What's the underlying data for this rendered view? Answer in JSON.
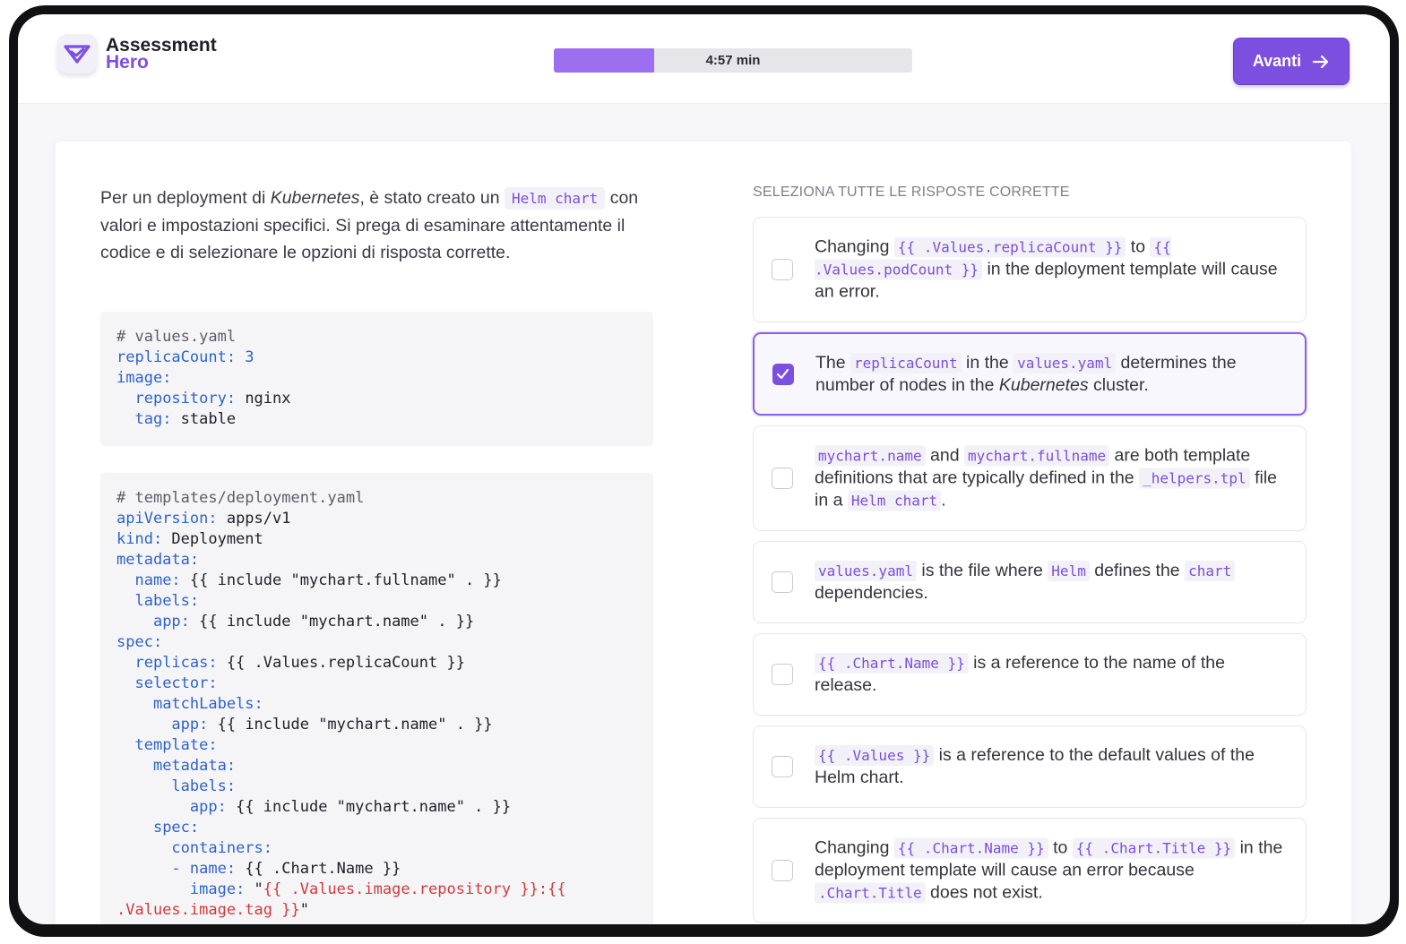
{
  "header": {
    "logo_line1": "Assessment",
    "logo_line2": "Hero",
    "timer_label": "4:57 min",
    "timer_progress": 0.28,
    "next_button": "Avanti"
  },
  "question": {
    "part1": "Per un deployment di ",
    "italic": "Kubernetes",
    "part2": ", è stato creato un ",
    "code": "Helm chart",
    "part3": " con valori e impostazioni specifici. Si prega di esaminare attentamente il codice e di selezionare le opzioni di risposta corrette."
  },
  "code_values": [
    [
      [
        "c",
        "# values.yaml"
      ]
    ],
    [
      [
        "k",
        "replicaCount: 3"
      ]
    ],
    [
      [
        "k",
        "image:"
      ]
    ],
    [
      [
        "",
        "  "
      ],
      [
        "k",
        "repository:"
      ],
      [
        "",
        " nginx"
      ]
    ],
    [
      [
        "",
        "  "
      ],
      [
        "k",
        "tag:"
      ],
      [
        "",
        " stable"
      ]
    ]
  ],
  "code_deployment": [
    [
      [
        "c",
        "# templates/deployment.yaml"
      ]
    ],
    [
      [
        "k",
        "apiVersion:"
      ],
      [
        "",
        " apps/v1"
      ]
    ],
    [
      [
        "k",
        "kind:"
      ],
      [
        "",
        " Deployment"
      ]
    ],
    [
      [
        "k",
        "metadata:"
      ]
    ],
    [
      [
        "",
        "  "
      ],
      [
        "k",
        "name:"
      ],
      [
        "",
        " {{ include \"mychart.fullname\" . }}"
      ]
    ],
    [
      [
        "",
        "  "
      ],
      [
        "k",
        "labels:"
      ]
    ],
    [
      [
        "",
        "    "
      ],
      [
        "k",
        "app:"
      ],
      [
        "",
        " {{ include \"mychart.name\" . }}"
      ]
    ],
    [
      [
        "k",
        "spec:"
      ]
    ],
    [
      [
        "",
        "  "
      ],
      [
        "k",
        "replicas:"
      ],
      [
        "",
        " {{ .Values.replicaCount }}"
      ]
    ],
    [
      [
        "",
        "  "
      ],
      [
        "k",
        "selector:"
      ]
    ],
    [
      [
        "",
        "    "
      ],
      [
        "k",
        "matchLabels:"
      ]
    ],
    [
      [
        "",
        "      "
      ],
      [
        "k",
        "app:"
      ],
      [
        "",
        " {{ include \"mychart.name\" . }}"
      ]
    ],
    [
      [
        "",
        "  "
      ],
      [
        "k",
        "template:"
      ]
    ],
    [
      [
        "",
        "    "
      ],
      [
        "k",
        "metadata:"
      ]
    ],
    [
      [
        "",
        "      "
      ],
      [
        "k",
        "labels:"
      ]
    ],
    [
      [
        "",
        "        "
      ],
      [
        "k",
        "app:"
      ],
      [
        "",
        " {{ include \"mychart.name\" . }}"
      ]
    ],
    [
      [
        "",
        "    "
      ],
      [
        "k",
        "spec:"
      ]
    ],
    [
      [
        "",
        "      "
      ],
      [
        "k",
        "containers:"
      ]
    ],
    [
      [
        "",
        "      "
      ],
      [
        "k",
        "- name:"
      ],
      [
        "",
        " {{ .Chart.Name }}"
      ]
    ],
    [
      [
        "",
        "        "
      ],
      [
        "k",
        "image:"
      ],
      [
        "",
        " \""
      ],
      [
        "s",
        "{{ .Values.image.repository }}:{{"
      ]
    ],
    [
      [
        "s",
        ".Values.image.tag }}"
      ],
      [
        "",
        "\""
      ]
    ]
  ],
  "answers_heading": "SELEZIONA TUTTE LE RISPOSTE CORRETTE",
  "options": [
    {
      "checked": false,
      "segments": [
        [
          "t",
          "Changing "
        ],
        [
          "m",
          "{{ .Values.replicaCount }}"
        ],
        [
          "t",
          " to "
        ],
        [
          "m",
          "{{ .Values.podCount }}"
        ],
        [
          "t",
          " in the deployment template will cause an error."
        ]
      ]
    },
    {
      "checked": true,
      "segments": [
        [
          "t",
          "The "
        ],
        [
          "m",
          "replicaCount"
        ],
        [
          "t",
          " in the "
        ],
        [
          "m",
          "values.yaml"
        ],
        [
          "t",
          " determines the number of nodes in the "
        ],
        [
          "i",
          "Kubernetes"
        ],
        [
          "t",
          " cluster."
        ]
      ]
    },
    {
      "checked": false,
      "segments": [
        [
          "m",
          "mychart.name"
        ],
        [
          "t",
          " and "
        ],
        [
          "m",
          "mychart.fullname"
        ],
        [
          "t",
          " are both template definitions that are typically defined in the "
        ],
        [
          "m",
          "_helpers.tpl"
        ],
        [
          "t",
          " file in a "
        ],
        [
          "m",
          "Helm chart"
        ],
        [
          "t",
          "."
        ]
      ]
    },
    {
      "checked": false,
      "segments": [
        [
          "m",
          "values.yaml"
        ],
        [
          "t",
          " is the file where "
        ],
        [
          "m",
          "Helm"
        ],
        [
          "t",
          " defines the "
        ],
        [
          "m",
          "chart"
        ],
        [
          "t",
          " dependencies."
        ]
      ]
    },
    {
      "checked": false,
      "segments": [
        [
          "m",
          "{{ .Chart.Name }}"
        ],
        [
          "t",
          " is a reference to the name of the release."
        ]
      ]
    },
    {
      "checked": false,
      "segments": [
        [
          "m",
          "{{ .Values }}"
        ],
        [
          "t",
          " is a reference to the default values of the Helm chart."
        ]
      ]
    },
    {
      "checked": false,
      "segments": [
        [
          "t",
          "Changing "
        ],
        [
          "m",
          "{{ .Chart.Name }}"
        ],
        [
          "t",
          " to "
        ],
        [
          "m",
          "{{ .Chart.Title }}"
        ],
        [
          "t",
          " in the deployment template will cause an error because "
        ],
        [
          "m",
          ".Chart.Title"
        ],
        [
          "t",
          " does not exist."
        ]
      ]
    }
  ],
  "colors": {
    "accent": "#7d4fe0",
    "progress_fill": "#9b6ff0",
    "code_key": "#2f63c8",
    "code_string": "#d03b3b"
  }
}
